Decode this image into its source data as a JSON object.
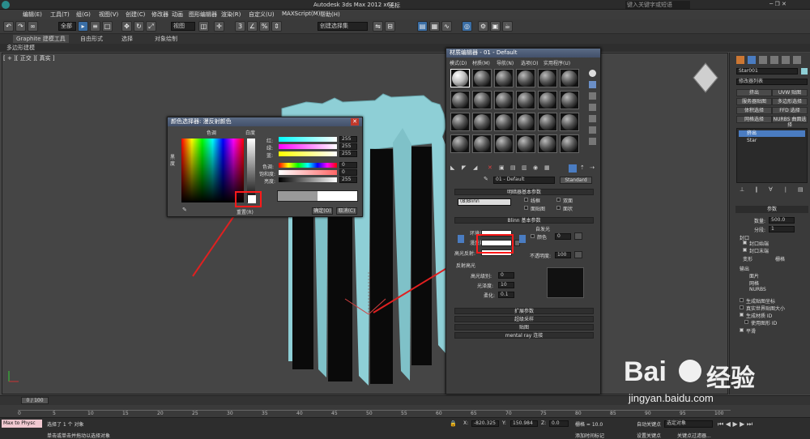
{
  "titlebar": {
    "title": "Autodesk 3ds Max  2012 x64",
    "doc": "无标",
    "search_placeholder": "键入关键字或短语"
  },
  "menu": [
    "编辑(E)",
    "工具(T)",
    "组(G)",
    "视图(V)",
    "创建(C)",
    "修改器",
    "动画",
    "图形编辑器",
    "渲染(R)",
    "自定义(U)",
    "MAXScript(M)",
    "帮助(H)"
  ],
  "toolbar": {
    "selection_filter": "全部",
    "view_combo": "视图",
    "named_selection": "创建选择集"
  },
  "ribbon": {
    "tabs": [
      "Graphite 建模工具",
      "自由形式",
      "选择",
      "对象绘制"
    ],
    "sub": "多边形建模"
  },
  "viewport": {
    "label": "[ + ][ 正交 ][ 真实 ]"
  },
  "color_dialog": {
    "title": "颜色选择器: 漫反射颜色",
    "hue_label": "色调",
    "white_label": "白度",
    "black_label": "黑度",
    "rows": [
      {
        "label": "红:",
        "value": "255"
      },
      {
        "label": "绿:",
        "value": "255"
      },
      {
        "label": "蓝:",
        "value": "255"
      },
      {
        "label": "色调:",
        "value": "0"
      },
      {
        "label": "饱和度:",
        "value": "0"
      },
      {
        "label": "亮度:",
        "value": "255"
      }
    ],
    "reset": "重置(R)",
    "ok": "确定(O)",
    "cancel": "取消(C)"
  },
  "material_editor": {
    "title": "材质编辑器 - 01 - Default",
    "menu": [
      "模式(D)",
      "材质(M)",
      "导航(N)",
      "选项(O)",
      "实用程序(U)"
    ],
    "material_name": "01 - Default",
    "type_button": "Standard",
    "shader_rollout": "明暗器基本参数",
    "shader": "(B)Blinn",
    "shader_opts": [
      "线框",
      "双面",
      "面贴图",
      "面状"
    ],
    "blinn_rollout": "Blinn 基本参数",
    "self_illum": "自发光",
    "color_label": "颜色",
    "ambient_label": "环境光:",
    "diffuse_label": "漫反射:",
    "specular_label": "高光反射:",
    "opacity_label": "不透明度:",
    "opacity_value": "100",
    "self_illum_value": "0",
    "spec_highlights": "反射高光",
    "spec_level_label": "高光级别:",
    "spec_level": "0",
    "glossiness_label": "光泽度:",
    "glossiness": "10",
    "soften_label": "柔化:",
    "soften": "0.1",
    "rollouts": [
      "扩展参数",
      "超级采样",
      "贴图",
      "mental ray 连接"
    ]
  },
  "command_panel": {
    "object_name": "Star001",
    "modifier_list": "修改器列表",
    "buttons": [
      "挤出",
      "UVW 贴图",
      "服务器贴图",
      "多边形选择",
      "体积选择",
      "FFD 选择",
      "网格选择",
      "NURBS 曲面选择"
    ],
    "stack": [
      "挤出",
      "Star"
    ],
    "params_title": "参数",
    "amount_label": "数量:",
    "amount": "500.0",
    "segments_label": "分段:",
    "segments": "1",
    "capping": "封口",
    "cap_start": "封口始端",
    "cap_end": "封口末端",
    "morph": "变形",
    "grid": "栅格",
    "output": "输出",
    "patch": "面片",
    "mesh": "网格",
    "nurbs": "NURBS",
    "gen_map": "生成贴图坐标",
    "real_world": "真实世界贴图大小",
    "gen_mat": "生成材质 ID",
    "use_shape": "使用图形 ID",
    "smooth": "平滑"
  },
  "timeline": {
    "frame": "0 / 100",
    "ticks": [
      "0",
      "5",
      "10",
      "15",
      "20",
      "25",
      "30",
      "35",
      "40",
      "45",
      "50",
      "55",
      "60",
      "65",
      "70",
      "75",
      "80",
      "85",
      "90",
      "95",
      "100"
    ]
  },
  "status": {
    "script": "Max to Physc",
    "msg1": "选择了 1 个 对象",
    "msg2": "单击或单击并拖动以选择对象",
    "x": "-820.325",
    "y": "150.984",
    "z": "0.0",
    "grid": "栅格 = 10.0",
    "add_tag": "添加时间标记",
    "auto_key": "自动关键点",
    "set_key": "设置关键点",
    "selected": "选定对象",
    "key_filters": "关键点过滤器..."
  },
  "watermark": {
    "brand": "Bai",
    "brand2": "经验",
    "url": "jingyan.baidu.com"
  }
}
